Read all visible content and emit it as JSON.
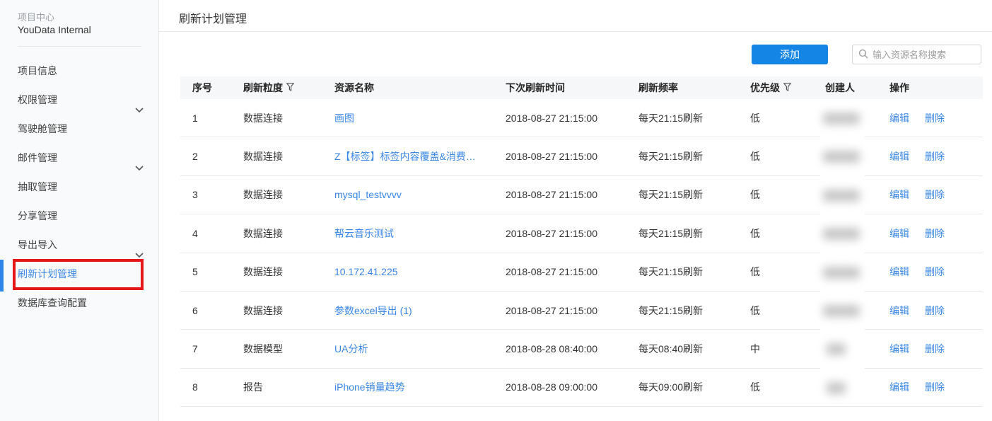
{
  "sidebar": {
    "project_label": "项目中心",
    "project_name": "YouData Internal",
    "items": [
      {
        "label": "项目信息",
        "expandable": false,
        "active": false
      },
      {
        "label": "权限管理",
        "expandable": true,
        "active": false
      },
      {
        "label": "驾驶舱管理",
        "expandable": false,
        "active": false
      },
      {
        "label": "邮件管理",
        "expandable": true,
        "active": false
      },
      {
        "label": "抽取管理",
        "expandable": false,
        "active": false
      },
      {
        "label": "分享管理",
        "expandable": false,
        "active": false
      },
      {
        "label": "导出导入",
        "expandable": true,
        "active": false
      },
      {
        "label": "刷新计划管理",
        "expandable": false,
        "active": true,
        "annotated": true
      },
      {
        "label": "数据库查询配置",
        "expandable": false,
        "active": false
      }
    ]
  },
  "header": {
    "title": "刷新计划管理"
  },
  "toolbar": {
    "add_label": "添加",
    "search_placeholder": "输入资源名称搜索",
    "search_value": "",
    "search_icon": "magnifier"
  },
  "table": {
    "columns": [
      {
        "label": "序号",
        "filter": false
      },
      {
        "label": "刷新粒度",
        "filter": true
      },
      {
        "label": "资源名称",
        "filter": false
      },
      {
        "label": "下次刷新时间",
        "filter": false
      },
      {
        "label": "刷新频率",
        "filter": false
      },
      {
        "label": "优先级",
        "filter": true
      },
      {
        "label": "创建人",
        "filter": false
      },
      {
        "label": "操作",
        "filter": false
      }
    ],
    "actions": {
      "edit": "编辑",
      "delete": "删除"
    },
    "rows": [
      {
        "index": "1",
        "granularity": "数据连接",
        "resource": "画图",
        "next_refresh": "2018-08-27 21:15:00",
        "frequency": "每天21:15刷新",
        "priority": "低",
        "creator_blurred": true
      },
      {
        "index": "2",
        "granularity": "数据连接",
        "resource": "Z【标签】标签内容覆盖&消费…",
        "next_refresh": "2018-08-27 21:15:00",
        "frequency": "每天21:15刷新",
        "priority": "低",
        "creator_blurred": true
      },
      {
        "index": "3",
        "granularity": "数据连接",
        "resource": "mysql_testvvvv",
        "next_refresh": "2018-08-27 21:15:00",
        "frequency": "每天21:15刷新",
        "priority": "低",
        "creator_blurred": true
      },
      {
        "index": "4",
        "granularity": "数据连接",
        "resource": "帮云音乐测试",
        "next_refresh": "2018-08-27 21:15:00",
        "frequency": "每天21:15刷新",
        "priority": "低",
        "creator_blurred": true
      },
      {
        "index": "5",
        "granularity": "数据连接",
        "resource": "10.172.41.225",
        "next_refresh": "2018-08-27 21:15:00",
        "frequency": "每天21:15刷新",
        "priority": "低",
        "creator_blurred": true
      },
      {
        "index": "6",
        "granularity": "数据连接",
        "resource": "参数excel导出 (1)",
        "next_refresh": "2018-08-27 21:15:00",
        "frequency": "每天21:15刷新",
        "priority": "低",
        "creator_blurred": true
      },
      {
        "index": "7",
        "granularity": "数据模型",
        "resource": "UA分析",
        "next_refresh": "2018-08-28 08:40:00",
        "frequency": "每天08:40刷新",
        "priority": "中",
        "creator_blurred": true
      },
      {
        "index": "8",
        "granularity": "报告",
        "resource": "iPhone销量趋势",
        "next_refresh": "2018-08-28 09:00:00",
        "frequency": "每天09:00刷新",
        "priority": "低",
        "creator_blurred": true
      }
    ]
  },
  "annotation": {
    "type": "highlight-box",
    "color": "#e51717",
    "target": "刷新计划管理"
  },
  "colors": {
    "accent_blue": "#3a87e8",
    "button_blue": "#1585e5",
    "sidebar_bg": "#f9fafb",
    "header_row_bg": "#f6f7f8",
    "border": "#e8e8e8",
    "annotation_red": "#e51717"
  }
}
